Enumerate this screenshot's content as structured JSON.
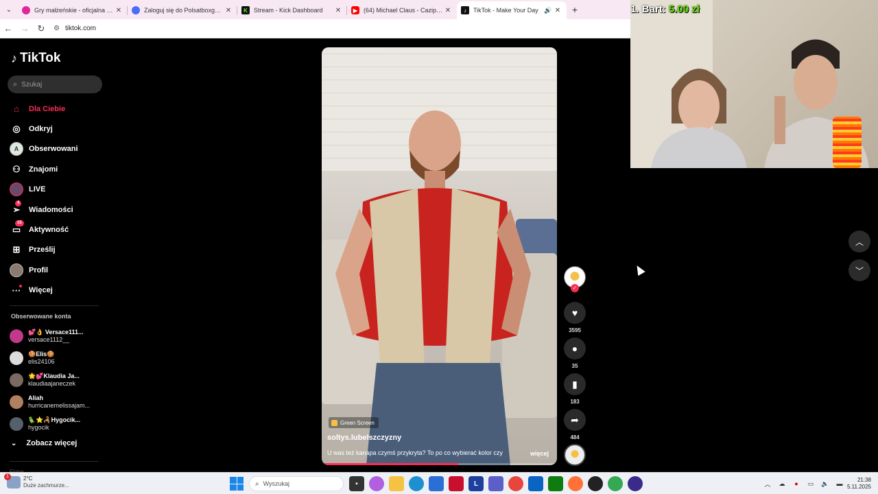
{
  "browser": {
    "tabs": [
      {
        "title": "Gry małżeńskie - oficjalna strona",
        "favicon_color": "#e0279c",
        "favicon": "logo-icon"
      },
      {
        "title": "Zaloguj się do Polsatboxgo.pl",
        "favicon_color": "#4a6cf7",
        "favicon": "globe-icon"
      },
      {
        "title": "Stream - Kick Dashboard",
        "favicon_color": "#111111",
        "favicon_glyph": "K"
      },
      {
        "title": "(64) Michael Claus - Cazip - YouTube",
        "favicon_color": "#ff0000",
        "favicon": "youtube-icon"
      },
      {
        "title": "TikTok - Make Your Day",
        "favicon_color": "#111111",
        "favicon": "tiktok-icon",
        "active": true
      }
    ],
    "url": "tiktok.com"
  },
  "sidebar": {
    "brand": "TikTok",
    "search_placeholder": "Szukaj",
    "nav": [
      {
        "label": "Dla Ciebie",
        "icon": "home-icon",
        "active": true
      },
      {
        "label": "Odkryj",
        "icon": "compass-icon"
      },
      {
        "label": "Obserwowani",
        "icon": "following-avatar-icon"
      },
      {
        "label": "Znajomi",
        "icon": "friends-icon"
      },
      {
        "label": "LIVE",
        "icon": "live-icon"
      },
      {
        "label": "Wiadomości",
        "icon": "messages-icon",
        "badge": "4"
      },
      {
        "label": "Aktywność",
        "icon": "activity-icon",
        "badge": "15"
      },
      {
        "label": "Prześlij",
        "icon": "upload-icon"
      },
      {
        "label": "Profil",
        "icon": "profile-icon"
      },
      {
        "label": "Więcej",
        "icon": "more-icon",
        "dot": true
      }
    ],
    "followed_title": "Obserwowane konta",
    "accounts": [
      {
        "name": "💕👌 Versace111...",
        "handle": "versace1112__",
        "color": "#c0398a"
      },
      {
        "name": "🍪Elis🍪",
        "handle": "elis24106",
        "color": "#dcdcdc"
      },
      {
        "name": "🌟💕Klaudia Ja...",
        "handle": "klaudiaajaneczek",
        "color": "#7a6a60"
      },
      {
        "name": "Aliah",
        "handle": "hurricanemelissajam...",
        "color": "#b08060"
      },
      {
        "name": "🦜⭐🦂Hygocik...",
        "handle": "hygocik",
        "color": "#55606a"
      }
    ],
    "see_more": "Zobacz więcej",
    "footer_cut": "Firma"
  },
  "video": {
    "effect": "Green Screen",
    "author": "soltys.lubelszczyzny",
    "caption": "U was też kanapa czymś przykryta? To po co wybierać kolor czy",
    "more": "więcej",
    "progress": 0.58
  },
  "actions": {
    "likes": "3595",
    "comments": "35",
    "saves": "183",
    "shares": "484"
  },
  "stream_overlay": {
    "donation_prefix": "1. Bart:",
    "donation_amount": "5.00 zł"
  },
  "taskbar": {
    "weather_temp": "2°C",
    "weather_desc": "Duże zachmurze...",
    "weather_badge": "1",
    "search_placeholder": "Wyszukaj",
    "time": "21:38",
    "date": "5.11.2025",
    "apps": [
      {
        "name": "task-view-icon",
        "color": "#333333"
      },
      {
        "name": "copilot-icon",
        "color": "#b060e0"
      },
      {
        "name": "file-explorer-icon",
        "color": "#f5c242"
      },
      {
        "name": "edge-icon",
        "color": "#1e90d0"
      },
      {
        "name": "store-icon",
        "color": "#2a6fd6"
      },
      {
        "name": "shield-app-icon",
        "color": "#c8102e"
      },
      {
        "name": "l-app-icon",
        "color": "#1d3f9e",
        "glyph": "L"
      },
      {
        "name": "teams-icon",
        "color": "#5b5fc7"
      },
      {
        "name": "chrome-icon",
        "color": "#e8453c"
      },
      {
        "name": "outlook-icon",
        "color": "#0a64c2"
      },
      {
        "name": "xbox-icon",
        "color": "#107c10"
      },
      {
        "name": "firefox-icon",
        "color": "#ff7139"
      },
      {
        "name": "obs-icon",
        "color": "#222222"
      },
      {
        "name": "chrome-active-icon",
        "color": "#34a853"
      },
      {
        "name": "app-circle-icon",
        "color": "#3b2a8a"
      }
    ]
  }
}
